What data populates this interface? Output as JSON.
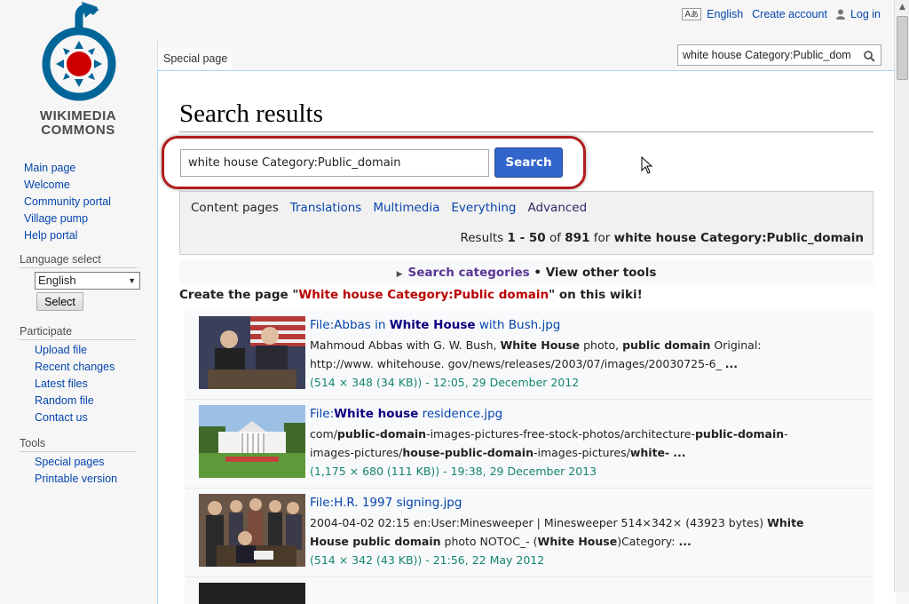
{
  "logo": {
    "line1": "WIKIMEDIA",
    "line2": "COMMONS",
    "colors": {
      "blue": "#006699",
      "red": "#cc0000"
    }
  },
  "sidebar": {
    "nav": [
      "Main page",
      "Welcome",
      "Community portal",
      "Village pump",
      "Help portal"
    ],
    "language": {
      "heading": "Language select",
      "selected": "English",
      "button": "Select"
    },
    "participate": {
      "heading": "Participate",
      "items": [
        "Upload file",
        "Recent changes",
        "Latest files",
        "Random file",
        "Contact us"
      ]
    },
    "tools": {
      "heading": "Tools",
      "items": [
        "Special pages",
        "Printable version"
      ]
    }
  },
  "personal": {
    "language": "English",
    "create_account": "Create account",
    "login": "Log in"
  },
  "tab": {
    "label": "Special page"
  },
  "top_search": {
    "value": "white house Category:Public_domain"
  },
  "page": {
    "title": "Search results"
  },
  "main_search": {
    "value": "white house Category:Public_domain",
    "button": "Search"
  },
  "filters": {
    "current": "Content pages",
    "items": [
      "Translations",
      "Multimedia",
      "Everything"
    ],
    "advanced": "Advanced"
  },
  "results_info": {
    "prefix": "Results ",
    "range": "1 - 50",
    "of": " of ",
    "total": "891",
    "for": " for ",
    "query": "white house Category:Public_domain"
  },
  "tools_bar": {
    "search_categories": "Search categories",
    "sep": " • ",
    "view_tools": "View other tools"
  },
  "create_page": {
    "prefix": "Create the page \"",
    "name": "White house Category:Public domain",
    "suffix": "\" on this wiki!"
  },
  "results": [
    {
      "title_a": "File:Abbas in ",
      "title_b": "White House",
      "title_c": " with Bush.jpg",
      "snip1": "Mahmoud Abbas with G. W. Bush, <b>White House</b> photo, <b>public domain</b> Original:",
      "snip2": "http://www. whitehouse. gov/news/releases/2003/07/images/20030725-6_ <b>...</b>",
      "meta": "(514 × 348 (34 KB)) - 12:05, 29 December 2012"
    },
    {
      "title_a": "File:",
      "title_b": "White house",
      "title_c": " residence.jpg",
      "snip1": "com/<b>public-domain</b>-images-pictures-free-stock-photos/architecture-<b>public-domain</b>-",
      "snip2": "images-pictures/<b>house-public-domain</b>-images-pictures/<b>white-</b> <b>...</b>",
      "meta": "(1,175 × 680 (111 KB)) - 19:38, 29 December 2013"
    },
    {
      "title_a": "File:H.R. 1997 signing.jpg",
      "title_b": "",
      "title_c": "",
      "snip1": "2004-04-02 02:15 en:User:Minesweeper | Minesweeper 514×342× (43923 bytes) <b>White</b>",
      "snip2": "<b>House public domain</b> photo NOTOC_- (<b>White House</b>)Category: <b>...</b>",
      "meta": "(514 × 342 (43 KB)) - 21:56, 22 May 2012"
    }
  ],
  "colors": {
    "link": "#0645ad",
    "button": "#3366cc",
    "highlight_ring": "#b21c1c",
    "meta_green": "#14866d"
  }
}
